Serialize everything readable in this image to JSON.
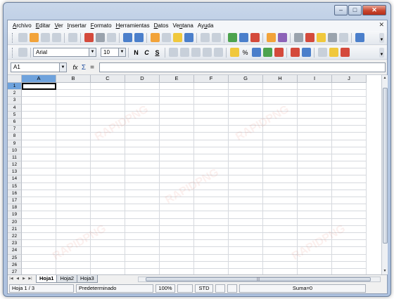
{
  "window": {
    "caption_buttons": [
      "–",
      "□",
      "✕"
    ]
  },
  "menubar": {
    "items": [
      {
        "label": "Archivo",
        "acc": "A",
        "rest": "rchivo"
      },
      {
        "label": "Editar",
        "acc": "E",
        "rest": "ditar"
      },
      {
        "label": "Ver",
        "acc": "V",
        "rest": "er"
      },
      {
        "label": "Insertar",
        "acc": "I",
        "rest": "nsertar"
      },
      {
        "label": "Formato",
        "acc": "F",
        "rest": "ormato"
      },
      {
        "label": "Herramientas",
        "acc": "H",
        "rest": "erramientas"
      },
      {
        "label": "Datos",
        "acc": "D",
        "rest": "atos"
      },
      {
        "label": "Ventana",
        "acc": "n",
        "pre": "Ve",
        "rest": "tana"
      },
      {
        "label": "Ayuda",
        "acc": "u",
        "pre": "Ay",
        "rest": "da"
      }
    ],
    "close_glyph": "✕"
  },
  "format_bar": {
    "font_name": "Arial",
    "font_size": "10",
    "bold": "N",
    "italic": "C",
    "underline": "S",
    "percent": "%"
  },
  "formula_bar": {
    "name_box": "A1",
    "fx": "fx",
    "sigma": "Σ",
    "equals": "="
  },
  "grid": {
    "columns": [
      "A",
      "B",
      "C",
      "D",
      "E",
      "F",
      "G",
      "H",
      "I",
      "J"
    ],
    "rows": [
      "1",
      "2",
      "3",
      "4",
      "5",
      "6",
      "7",
      "8",
      "9",
      "10",
      "11",
      "12",
      "13",
      "14",
      "15",
      "16",
      "17",
      "18",
      "19",
      "20",
      "21",
      "22",
      "23",
      "24",
      "25",
      "26",
      "27"
    ],
    "active_cell": "A1"
  },
  "sheets": {
    "tabs": [
      "Hoja1",
      "Hoja2",
      "Hoja3"
    ],
    "active": "Hoja1",
    "hscroll_grip": "|||"
  },
  "statusbar": {
    "sheet_position": "Hoja 1 / 3",
    "page_style": "Predeterminado",
    "zoom": "100%",
    "selection_mode": "STD",
    "sum": "Suma=0"
  },
  "watermark_text": "RAPIDPNG"
}
